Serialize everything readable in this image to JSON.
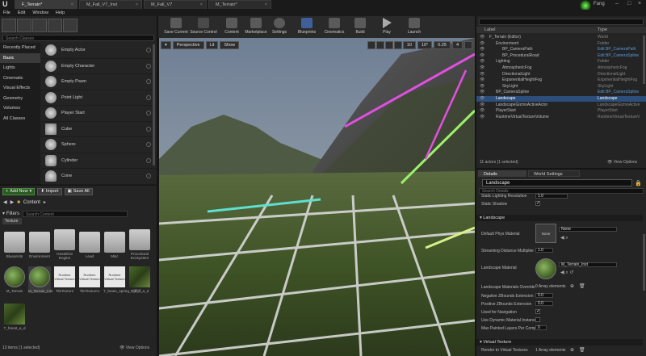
{
  "doc_tabs": [
    "F_Terrain*",
    "M_Fall_V7_Inst",
    "M_Fall_V7",
    "M_Terrain*"
  ],
  "menu": [
    "File",
    "Edit",
    "Window",
    "Help"
  ],
  "user": "Fang",
  "place_actors": {
    "search_placeholder": "Search Classes",
    "categories": [
      "Recently Placed",
      "Basic",
      "Lights",
      "Cinematic",
      "Visual Effects",
      "Geometry",
      "Volumes",
      "All Classes"
    ],
    "actors": [
      "Empty Actor",
      "Empty Character",
      "Empty Pawn",
      "Point Light",
      "Player Start",
      "Cube",
      "Sphere",
      "Cylinder",
      "Cone"
    ]
  },
  "content_browser": {
    "add_new": "Add New",
    "import": "Import",
    "save_all": "Save All",
    "path": "Content",
    "filters": "Filters",
    "search_placeholder": "Search Content",
    "filter_tag": "Texture",
    "folders": [
      "Blueprints",
      "Environment",
      "Headshot Engine",
      "Lead",
      "Misc",
      "Procedural Ecosystem"
    ],
    "assets": [
      {
        "label": "M_Terrain",
        "kind": "mat",
        "thumb_text": ""
      },
      {
        "label": "M_Terrain_Inst",
        "kind": "mat",
        "thumb_text": ""
      },
      {
        "label": "TileTexture",
        "kind": "rvt",
        "thumb_text": "Runtime Virtual Texture"
      },
      {
        "label": "TileTexture1",
        "kind": "rvt",
        "thumb_text": "Runtime Virtual Texture"
      },
      {
        "label": "T_beam_spring_cliff_...",
        "kind": "rvt",
        "thumb_text": "Runtime Virtual Texture"
      },
      {
        "label": "T_cliff_a_d",
        "kind": "tex",
        "thumb_text": ""
      },
      {
        "label": "T_forest_a_d",
        "kind": "tex",
        "thumb_text": ""
      }
    ],
    "status": "13 items (1 selected)",
    "view_options": "View Options"
  },
  "toolbar": [
    "Save Current",
    "Source Control",
    "Content",
    "Marketplace",
    "Settings",
    "Blueprints",
    "Cinematics",
    "Build",
    "Play",
    "Launch"
  ],
  "viewport": {
    "perspective": "Perspective",
    "lit": "Lit",
    "show": "Show",
    "grid_snap": "10",
    "rot_snap": "10°",
    "scale_snap": "0.25",
    "cam_speed": "4"
  },
  "outliner": {
    "search_placeholder": "",
    "col_label": "Label",
    "col_type": "Type",
    "rows": [
      {
        "label": "F_Terrain (Editor)",
        "type": "World",
        "indent": 0,
        "link": false,
        "sel": false
      },
      {
        "label": "Environment",
        "type": "Folder",
        "indent": 1,
        "link": false,
        "sel": false
      },
      {
        "label": "BP_CameraPath",
        "type": "Edit BP_CameraPath",
        "indent": 2,
        "link": true,
        "sel": false
      },
      {
        "label": "BP_ProceduralRoad",
        "type": "Edit BP_CameraSpline",
        "indent": 2,
        "link": true,
        "sel": false
      },
      {
        "label": "Lighting",
        "type": "Folder",
        "indent": 1,
        "link": false,
        "sel": false
      },
      {
        "label": "AtmosphericFog",
        "type": "AtmosphericFog",
        "indent": 2,
        "link": false,
        "sel": false
      },
      {
        "label": "DirectionalLight",
        "type": "DirectionalLight",
        "indent": 2,
        "link": false,
        "sel": false
      },
      {
        "label": "ExponentialHeightFog",
        "type": "ExponentialHeightFog",
        "indent": 2,
        "link": false,
        "sel": false
      },
      {
        "label": "SkyLight",
        "type": "SkyLight",
        "indent": 2,
        "link": false,
        "sel": false
      },
      {
        "label": "BP_CameraSpline",
        "type": "Edit BP_CameraSpline",
        "indent": 1,
        "link": true,
        "sel": false
      },
      {
        "label": "Landscape",
        "type": "Landscape",
        "indent": 1,
        "link": false,
        "sel": true
      },
      {
        "label": "LandscapeGizmoActiveActor",
        "type": "LandscapeGizmoActive",
        "indent": 1,
        "link": false,
        "sel": false
      },
      {
        "label": "PlayerStart",
        "type": "PlayerStart",
        "indent": 1,
        "link": false,
        "sel": false
      },
      {
        "label": "RuntimeVirtualTextureVolume",
        "type": "RuntimeVirtualTextureV",
        "indent": 1,
        "link": false,
        "sel": false
      }
    ],
    "status": "11 actors (1 selected)",
    "view_options": "View Options"
  },
  "details": {
    "tab_details": "Details",
    "tab_world": "World Settings",
    "actor_name": "Landscape",
    "search_placeholder": "Search Details",
    "static_lighting_resolution_label": "Static Lighting Resolution",
    "static_lighting_resolution": "1.0",
    "static_shadow_label": "Static Shadow",
    "section_landscape": "Landscape",
    "default_phys_material_label": "Default Phys Material",
    "default_phys_material": "None",
    "phys_thumb": "None",
    "streaming_distance_label": "Streaming Distance Multiplier",
    "streaming_distance": "1.0",
    "landscape_material_label": "Landscape Material",
    "landscape_material": "M_Terrain_Inst",
    "materials_override_label": "Landscape Materials Override",
    "materials_override": "0 Array elements",
    "neg_z_label": "Negative ZBounds Extension",
    "neg_z": "0.0",
    "pos_z_label": "Positive ZBounds Extension",
    "pos_z": "0.0",
    "used_for_navigation_label": "Used for Navigation",
    "dynamic_material_label": "Use Dynamic Material Instance",
    "max_painted_layers_label": "Max Painted Layers Per Comp",
    "max_painted_layers": "0",
    "section_virtual_texture": "Virtual Texture",
    "render_to_vt_label": "Render to Virtual Textures",
    "render_to_vt": "1 Array elements"
  }
}
